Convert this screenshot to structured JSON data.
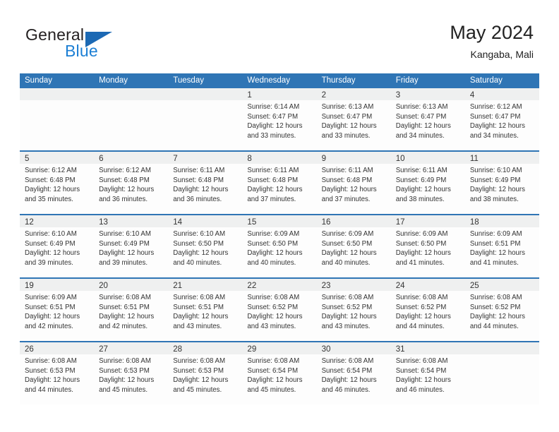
{
  "brand": {
    "name_top": "General",
    "name_bottom": "Blue",
    "triangle_color": "#1c69b4",
    "blue_text_color": "#1c7fd4"
  },
  "header": {
    "title": "May 2024",
    "subtitle": "Kangaba, Mali"
  },
  "theme": {
    "header_blue": "#2f75b5",
    "day_band_gray": "#eff0f0",
    "cell_background": "#fdfdfd",
    "text_color": "#333333"
  },
  "weekdays": [
    "Sunday",
    "Monday",
    "Tuesday",
    "Wednesday",
    "Thursday",
    "Friday",
    "Saturday"
  ],
  "weeks": [
    [
      {
        "date": "",
        "sunrise": "",
        "sunset": "",
        "daylight_line1": "",
        "daylight_line2": ""
      },
      {
        "date": "",
        "sunrise": "",
        "sunset": "",
        "daylight_line1": "",
        "daylight_line2": ""
      },
      {
        "date": "",
        "sunrise": "",
        "sunset": "",
        "daylight_line1": "",
        "daylight_line2": ""
      },
      {
        "date": "1",
        "sunrise": "Sunrise: 6:14 AM",
        "sunset": "Sunset: 6:47 PM",
        "daylight_line1": "Daylight: 12 hours",
        "daylight_line2": "and 33 minutes."
      },
      {
        "date": "2",
        "sunrise": "Sunrise: 6:13 AM",
        "sunset": "Sunset: 6:47 PM",
        "daylight_line1": "Daylight: 12 hours",
        "daylight_line2": "and 33 minutes."
      },
      {
        "date": "3",
        "sunrise": "Sunrise: 6:13 AM",
        "sunset": "Sunset: 6:47 PM",
        "daylight_line1": "Daylight: 12 hours",
        "daylight_line2": "and 34 minutes."
      },
      {
        "date": "4",
        "sunrise": "Sunrise: 6:12 AM",
        "sunset": "Sunset: 6:47 PM",
        "daylight_line1": "Daylight: 12 hours",
        "daylight_line2": "and 34 minutes."
      }
    ],
    [
      {
        "date": "5",
        "sunrise": "Sunrise: 6:12 AM",
        "sunset": "Sunset: 6:48 PM",
        "daylight_line1": "Daylight: 12 hours",
        "daylight_line2": "and 35 minutes."
      },
      {
        "date": "6",
        "sunrise": "Sunrise: 6:12 AM",
        "sunset": "Sunset: 6:48 PM",
        "daylight_line1": "Daylight: 12 hours",
        "daylight_line2": "and 36 minutes."
      },
      {
        "date": "7",
        "sunrise": "Sunrise: 6:11 AM",
        "sunset": "Sunset: 6:48 PM",
        "daylight_line1": "Daylight: 12 hours",
        "daylight_line2": "and 36 minutes."
      },
      {
        "date": "8",
        "sunrise": "Sunrise: 6:11 AM",
        "sunset": "Sunset: 6:48 PM",
        "daylight_line1": "Daylight: 12 hours",
        "daylight_line2": "and 37 minutes."
      },
      {
        "date": "9",
        "sunrise": "Sunrise: 6:11 AM",
        "sunset": "Sunset: 6:48 PM",
        "daylight_line1": "Daylight: 12 hours",
        "daylight_line2": "and 37 minutes."
      },
      {
        "date": "10",
        "sunrise": "Sunrise: 6:11 AM",
        "sunset": "Sunset: 6:49 PM",
        "daylight_line1": "Daylight: 12 hours",
        "daylight_line2": "and 38 minutes."
      },
      {
        "date": "11",
        "sunrise": "Sunrise: 6:10 AM",
        "sunset": "Sunset: 6:49 PM",
        "daylight_line1": "Daylight: 12 hours",
        "daylight_line2": "and 38 minutes."
      }
    ],
    [
      {
        "date": "12",
        "sunrise": "Sunrise: 6:10 AM",
        "sunset": "Sunset: 6:49 PM",
        "daylight_line1": "Daylight: 12 hours",
        "daylight_line2": "and 39 minutes."
      },
      {
        "date": "13",
        "sunrise": "Sunrise: 6:10 AM",
        "sunset": "Sunset: 6:49 PM",
        "daylight_line1": "Daylight: 12 hours",
        "daylight_line2": "and 39 minutes."
      },
      {
        "date": "14",
        "sunrise": "Sunrise: 6:10 AM",
        "sunset": "Sunset: 6:50 PM",
        "daylight_line1": "Daylight: 12 hours",
        "daylight_line2": "and 40 minutes."
      },
      {
        "date": "15",
        "sunrise": "Sunrise: 6:09 AM",
        "sunset": "Sunset: 6:50 PM",
        "daylight_line1": "Daylight: 12 hours",
        "daylight_line2": "and 40 minutes."
      },
      {
        "date": "16",
        "sunrise": "Sunrise: 6:09 AM",
        "sunset": "Sunset: 6:50 PM",
        "daylight_line1": "Daylight: 12 hours",
        "daylight_line2": "and 40 minutes."
      },
      {
        "date": "17",
        "sunrise": "Sunrise: 6:09 AM",
        "sunset": "Sunset: 6:50 PM",
        "daylight_line1": "Daylight: 12 hours",
        "daylight_line2": "and 41 minutes."
      },
      {
        "date": "18",
        "sunrise": "Sunrise: 6:09 AM",
        "sunset": "Sunset: 6:51 PM",
        "daylight_line1": "Daylight: 12 hours",
        "daylight_line2": "and 41 minutes."
      }
    ],
    [
      {
        "date": "19",
        "sunrise": "Sunrise: 6:09 AM",
        "sunset": "Sunset: 6:51 PM",
        "daylight_line1": "Daylight: 12 hours",
        "daylight_line2": "and 42 minutes."
      },
      {
        "date": "20",
        "sunrise": "Sunrise: 6:08 AM",
        "sunset": "Sunset: 6:51 PM",
        "daylight_line1": "Daylight: 12 hours",
        "daylight_line2": "and 42 minutes."
      },
      {
        "date": "21",
        "sunrise": "Sunrise: 6:08 AM",
        "sunset": "Sunset: 6:51 PM",
        "daylight_line1": "Daylight: 12 hours",
        "daylight_line2": "and 43 minutes."
      },
      {
        "date": "22",
        "sunrise": "Sunrise: 6:08 AM",
        "sunset": "Sunset: 6:52 PM",
        "daylight_line1": "Daylight: 12 hours",
        "daylight_line2": "and 43 minutes."
      },
      {
        "date": "23",
        "sunrise": "Sunrise: 6:08 AM",
        "sunset": "Sunset: 6:52 PM",
        "daylight_line1": "Daylight: 12 hours",
        "daylight_line2": "and 43 minutes."
      },
      {
        "date": "24",
        "sunrise": "Sunrise: 6:08 AM",
        "sunset": "Sunset: 6:52 PM",
        "daylight_line1": "Daylight: 12 hours",
        "daylight_line2": "and 44 minutes."
      },
      {
        "date": "25",
        "sunrise": "Sunrise: 6:08 AM",
        "sunset": "Sunset: 6:52 PM",
        "daylight_line1": "Daylight: 12 hours",
        "daylight_line2": "and 44 minutes."
      }
    ],
    [
      {
        "date": "26",
        "sunrise": "Sunrise: 6:08 AM",
        "sunset": "Sunset: 6:53 PM",
        "daylight_line1": "Daylight: 12 hours",
        "daylight_line2": "and 44 minutes."
      },
      {
        "date": "27",
        "sunrise": "Sunrise: 6:08 AM",
        "sunset": "Sunset: 6:53 PM",
        "daylight_line1": "Daylight: 12 hours",
        "daylight_line2": "and 45 minutes."
      },
      {
        "date": "28",
        "sunrise": "Sunrise: 6:08 AM",
        "sunset": "Sunset: 6:53 PM",
        "daylight_line1": "Daylight: 12 hours",
        "daylight_line2": "and 45 minutes."
      },
      {
        "date": "29",
        "sunrise": "Sunrise: 6:08 AM",
        "sunset": "Sunset: 6:54 PM",
        "daylight_line1": "Daylight: 12 hours",
        "daylight_line2": "and 45 minutes."
      },
      {
        "date": "30",
        "sunrise": "Sunrise: 6:08 AM",
        "sunset": "Sunset: 6:54 PM",
        "daylight_line1": "Daylight: 12 hours",
        "daylight_line2": "and 46 minutes."
      },
      {
        "date": "31",
        "sunrise": "Sunrise: 6:08 AM",
        "sunset": "Sunset: 6:54 PM",
        "daylight_line1": "Daylight: 12 hours",
        "daylight_line2": "and 46 minutes."
      },
      {
        "date": "",
        "sunrise": "",
        "sunset": "",
        "daylight_line1": "",
        "daylight_line2": ""
      }
    ]
  ]
}
